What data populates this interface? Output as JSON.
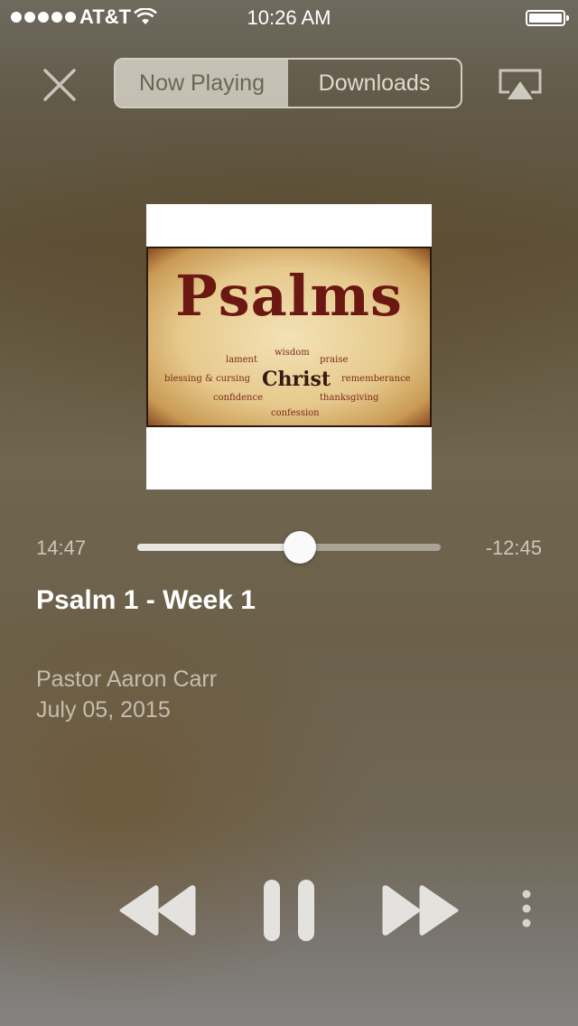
{
  "status_bar": {
    "carrier": "AT&T",
    "time": "10:26 AM",
    "signal_bars": 5
  },
  "header": {
    "close_icon": "close-icon",
    "tabs": [
      {
        "label": "Now Playing",
        "active": true
      },
      {
        "label": "Downloads",
        "active": false
      }
    ],
    "airplay_icon": "airplay-icon"
  },
  "artwork": {
    "title": "Psalms",
    "words": {
      "lament": "lament",
      "wisdom": "wisdom",
      "praise": "praise",
      "blessing": "blessing & cursing",
      "christ": "Christ",
      "remembrance": "rememberance",
      "confidence": "confidence",
      "thanksgiving": "thanksgiving",
      "confession": "confession"
    }
  },
  "progress": {
    "elapsed": "14:47",
    "remaining": "-12:45",
    "fraction": 0.536
  },
  "track": {
    "title": "Psalm 1 - Week 1",
    "artist": "Pastor Aaron Carr",
    "date": "July 05, 2015"
  },
  "controls": {
    "rewind": "rewind-icon",
    "pause": "pause-icon",
    "fast_forward": "fast-forward-icon",
    "more": "more-icon"
  },
  "colors": {
    "accent": "#e8e6e1",
    "active_tab_text": "#6b6552"
  }
}
